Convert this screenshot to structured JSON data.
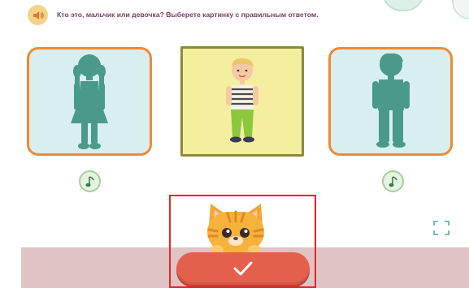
{
  "header": {
    "prompt_text": "Кто это, мальчик или девочка? Выберете  картинку с правильным ответом."
  },
  "icons": {
    "speaker": "speaker-icon",
    "note_left": "music-note-icon",
    "note_right": "music-note-icon",
    "fullscreen": "fullscreen-icon",
    "check": "checkmark-icon"
  },
  "options": [
    {
      "id": "girl-silhouette",
      "selected": false
    },
    {
      "id": "boy-picture",
      "selected": true
    },
    {
      "id": "boy-silhouette",
      "selected": false
    }
  ],
  "colors": {
    "prompt": "#7a3c6a",
    "card_border": "#f08a32",
    "card_bg": "#d9eeee",
    "selected_bg": "#f3ef9e",
    "silhouette": "#4a9a8a",
    "check_button": "#e5604c",
    "highlight": "#e52523"
  }
}
